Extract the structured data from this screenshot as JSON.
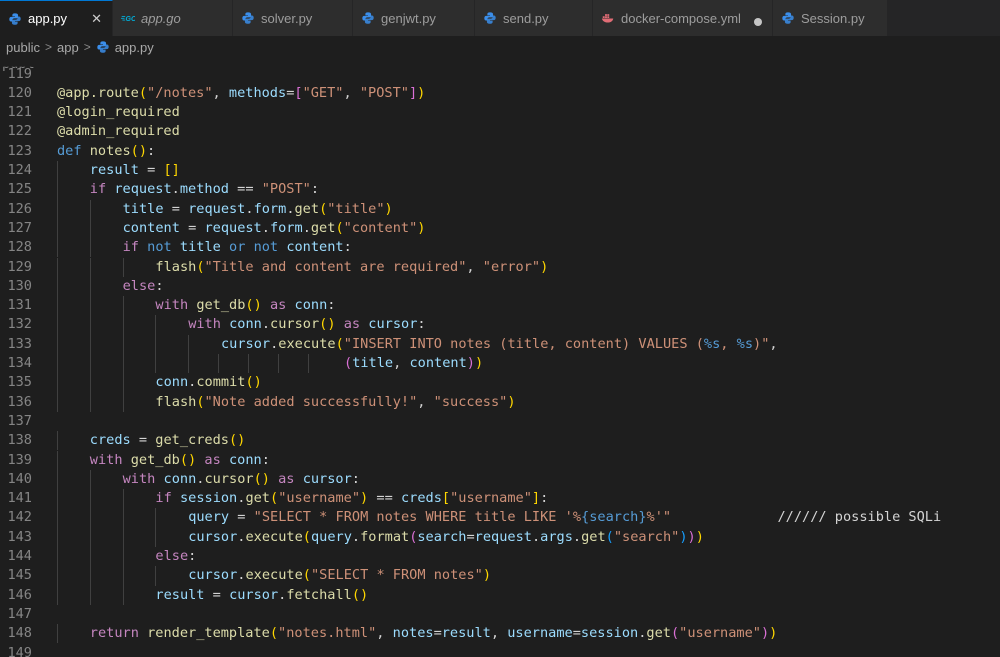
{
  "tabs": [
    {
      "label": "app.py",
      "icon": "python-icon",
      "active": true,
      "italic": false,
      "state": "close"
    },
    {
      "label": "app.go",
      "icon": "go-icon",
      "active": false,
      "italic": true,
      "state": ""
    },
    {
      "label": "solver.py",
      "icon": "python-icon",
      "active": false,
      "italic": false,
      "state": ""
    },
    {
      "label": "genjwt.py",
      "icon": "python-icon",
      "active": false,
      "italic": false,
      "state": ""
    },
    {
      "label": "send.py",
      "icon": "python-icon",
      "active": false,
      "italic": false,
      "state": ""
    },
    {
      "label": "docker-compose.yml",
      "icon": "docker-icon",
      "active": false,
      "italic": false,
      "state": "modified"
    },
    {
      "label": "Session.py",
      "icon": "python-icon",
      "active": false,
      "italic": false,
      "state": ""
    }
  ],
  "tab_close_glyph": "✕",
  "breadcrumb": {
    "items": [
      "public",
      "app",
      "app.py"
    ],
    "separator": ">"
  },
  "editor": {
    "top_partial_label": "public",
    "lines": [
      {
        "n": "119",
        "indent": 0,
        "tokens": []
      },
      {
        "n": "120",
        "indent": 0,
        "tokens": [
          [
            "deco",
            "@app.route"
          ],
          [
            "br1",
            "("
          ],
          [
            "str",
            "\"/notes\""
          ],
          [
            "plain",
            ", "
          ],
          [
            "var",
            "methods"
          ],
          [
            "plain",
            "="
          ],
          [
            "br2",
            "["
          ],
          [
            "str",
            "\"GET\""
          ],
          [
            "plain",
            ", "
          ],
          [
            "str",
            "\"POST\""
          ],
          [
            "br2",
            "]"
          ],
          [
            "br1",
            ")"
          ]
        ]
      },
      {
        "n": "121",
        "indent": 0,
        "tokens": [
          [
            "deco",
            "@login_required"
          ]
        ]
      },
      {
        "n": "122",
        "indent": 0,
        "tokens": [
          [
            "deco",
            "@admin_required"
          ]
        ]
      },
      {
        "n": "123",
        "indent": 0,
        "tokens": [
          [
            "kw",
            "def "
          ],
          [
            "fn",
            "notes"
          ],
          [
            "br1",
            "()"
          ],
          [
            "plain",
            ":"
          ]
        ]
      },
      {
        "n": "124",
        "indent": 1,
        "tokens": [
          [
            "var",
            "result"
          ],
          [
            "plain",
            " = "
          ],
          [
            "br1",
            "[]"
          ]
        ]
      },
      {
        "n": "125",
        "indent": 1,
        "tokens": [
          [
            "ctrl",
            "if "
          ],
          [
            "var",
            "request"
          ],
          [
            "plain",
            "."
          ],
          [
            "var",
            "method"
          ],
          [
            "plain",
            " == "
          ],
          [
            "str",
            "\"POST\""
          ],
          [
            "plain",
            ":"
          ]
        ]
      },
      {
        "n": "126",
        "indent": 2,
        "tokens": [
          [
            "var",
            "title"
          ],
          [
            "plain",
            " = "
          ],
          [
            "var",
            "request"
          ],
          [
            "plain",
            "."
          ],
          [
            "var",
            "form"
          ],
          [
            "plain",
            "."
          ],
          [
            "fn",
            "get"
          ],
          [
            "br1",
            "("
          ],
          [
            "str",
            "\"title\""
          ],
          [
            "br1",
            ")"
          ]
        ]
      },
      {
        "n": "127",
        "indent": 2,
        "tokens": [
          [
            "var",
            "content"
          ],
          [
            "plain",
            " = "
          ],
          [
            "var",
            "request"
          ],
          [
            "plain",
            "."
          ],
          [
            "var",
            "form"
          ],
          [
            "plain",
            "."
          ],
          [
            "fn",
            "get"
          ],
          [
            "br1",
            "("
          ],
          [
            "str",
            "\"content\""
          ],
          [
            "br1",
            ")"
          ]
        ]
      },
      {
        "n": "128",
        "indent": 2,
        "tokens": [
          [
            "ctrl",
            "if "
          ],
          [
            "kw",
            "not "
          ],
          [
            "var",
            "title "
          ],
          [
            "kw",
            "or not "
          ],
          [
            "var",
            "content"
          ],
          [
            "plain",
            ":"
          ]
        ]
      },
      {
        "n": "129",
        "indent": 3,
        "tokens": [
          [
            "fn",
            "flash"
          ],
          [
            "br1",
            "("
          ],
          [
            "str",
            "\"Title and content are required\""
          ],
          [
            "plain",
            ", "
          ],
          [
            "str",
            "\"error\""
          ],
          [
            "br1",
            ")"
          ]
        ]
      },
      {
        "n": "130",
        "indent": 2,
        "tokens": [
          [
            "ctrl",
            "else"
          ],
          [
            "plain",
            ":"
          ]
        ]
      },
      {
        "n": "131",
        "indent": 3,
        "tokens": [
          [
            "ctrl",
            "with "
          ],
          [
            "fn",
            "get_db"
          ],
          [
            "br1",
            "()"
          ],
          [
            "ctrl",
            " as "
          ],
          [
            "var",
            "conn"
          ],
          [
            "plain",
            ":"
          ]
        ]
      },
      {
        "n": "132",
        "indent": 4,
        "tokens": [
          [
            "ctrl",
            "with "
          ],
          [
            "var",
            "conn"
          ],
          [
            "plain",
            "."
          ],
          [
            "fn",
            "cursor"
          ],
          [
            "br1",
            "()"
          ],
          [
            "ctrl",
            " as "
          ],
          [
            "var",
            "cursor"
          ],
          [
            "plain",
            ":"
          ]
        ]
      },
      {
        "n": "133",
        "indent": 5,
        "tokens": [
          [
            "var",
            "cursor"
          ],
          [
            "plain",
            "."
          ],
          [
            "fn",
            "execute"
          ],
          [
            "br1",
            "("
          ],
          [
            "str",
            "\"INSERT INTO notes (title, content) VALUES ("
          ],
          [
            "fmt",
            "%s"
          ],
          [
            "str",
            ", "
          ],
          [
            "fmt",
            "%s"
          ],
          [
            "str",
            ")\""
          ],
          [
            "plain",
            ","
          ]
        ]
      },
      {
        "n": "134",
        "indent": 5,
        "pad": 15,
        "tokens": [
          [
            "br2",
            "("
          ],
          [
            "var",
            "title"
          ],
          [
            "plain",
            ", "
          ],
          [
            "var",
            "content"
          ],
          [
            "br2",
            ")"
          ],
          [
            "br1",
            ")"
          ]
        ]
      },
      {
        "n": "135",
        "indent": 3,
        "tokens": [
          [
            "var",
            "conn"
          ],
          [
            "plain",
            "."
          ],
          [
            "fn",
            "commit"
          ],
          [
            "br1",
            "()"
          ]
        ]
      },
      {
        "n": "136",
        "indent": 3,
        "tokens": [
          [
            "fn",
            "flash"
          ],
          [
            "br1",
            "("
          ],
          [
            "str",
            "\"Note added successfully!\""
          ],
          [
            "plain",
            ", "
          ],
          [
            "str",
            "\"success\""
          ],
          [
            "br1",
            ")"
          ]
        ]
      },
      {
        "n": "137",
        "indent": 0,
        "tokens": []
      },
      {
        "n": "138",
        "indent": 1,
        "tokens": [
          [
            "var",
            "creds"
          ],
          [
            "plain",
            " = "
          ],
          [
            "fn",
            "get_creds"
          ],
          [
            "br1",
            "()"
          ]
        ]
      },
      {
        "n": "139",
        "indent": 1,
        "tokens": [
          [
            "ctrl",
            "with "
          ],
          [
            "fn",
            "get_db"
          ],
          [
            "br1",
            "()"
          ],
          [
            "ctrl",
            " as "
          ],
          [
            "var",
            "conn"
          ],
          [
            "plain",
            ":"
          ]
        ]
      },
      {
        "n": "140",
        "indent": 2,
        "tokens": [
          [
            "ctrl",
            "with "
          ],
          [
            "var",
            "conn"
          ],
          [
            "plain",
            "."
          ],
          [
            "fn",
            "cursor"
          ],
          [
            "br1",
            "()"
          ],
          [
            "ctrl",
            " as "
          ],
          [
            "var",
            "cursor"
          ],
          [
            "plain",
            ":"
          ]
        ]
      },
      {
        "n": "141",
        "indent": 3,
        "tokens": [
          [
            "ctrl",
            "if "
          ],
          [
            "var",
            "session"
          ],
          [
            "plain",
            "."
          ],
          [
            "fn",
            "get"
          ],
          [
            "br1",
            "("
          ],
          [
            "str",
            "\"username\""
          ],
          [
            "br1",
            ")"
          ],
          [
            "plain",
            " == "
          ],
          [
            "var",
            "creds"
          ],
          [
            "br1",
            "["
          ],
          [
            "str",
            "\"username\""
          ],
          [
            "br1",
            "]"
          ],
          [
            "plain",
            ":"
          ]
        ]
      },
      {
        "n": "142",
        "indent": 4,
        "tokens": [
          [
            "var",
            "query"
          ],
          [
            "plain",
            " = "
          ],
          [
            "str",
            "\"SELECT * FROM notes WHERE title LIKE '%"
          ],
          [
            "fmt",
            "{search}"
          ],
          [
            "str",
            "%'\""
          ],
          [
            "plain",
            "             ////// possible SQLi"
          ]
        ]
      },
      {
        "n": "143",
        "indent": 4,
        "tokens": [
          [
            "var",
            "cursor"
          ],
          [
            "plain",
            "."
          ],
          [
            "fn",
            "execute"
          ],
          [
            "br1",
            "("
          ],
          [
            "var",
            "query"
          ],
          [
            "plain",
            "."
          ],
          [
            "fn",
            "format"
          ],
          [
            "br2",
            "("
          ],
          [
            "var",
            "search"
          ],
          [
            "plain",
            "="
          ],
          [
            "var",
            "request"
          ],
          [
            "plain",
            "."
          ],
          [
            "var",
            "args"
          ],
          [
            "plain",
            "."
          ],
          [
            "fn",
            "get"
          ],
          [
            "br3",
            "("
          ],
          [
            "str",
            "\"search\""
          ],
          [
            "br3",
            ")"
          ],
          [
            "br2",
            ")"
          ],
          [
            "br1",
            ")"
          ]
        ]
      },
      {
        "n": "144",
        "indent": 3,
        "tokens": [
          [
            "ctrl",
            "else"
          ],
          [
            "plain",
            ":"
          ]
        ]
      },
      {
        "n": "145",
        "indent": 4,
        "tokens": [
          [
            "var",
            "cursor"
          ],
          [
            "plain",
            "."
          ],
          [
            "fn",
            "execute"
          ],
          [
            "br1",
            "("
          ],
          [
            "str",
            "\"SELECT * FROM notes\""
          ],
          [
            "br1",
            ")"
          ]
        ]
      },
      {
        "n": "146",
        "indent": 3,
        "tokens": [
          [
            "var",
            "result"
          ],
          [
            "plain",
            " = "
          ],
          [
            "var",
            "cursor"
          ],
          [
            "plain",
            "."
          ],
          [
            "fn",
            "fetchall"
          ],
          [
            "br1",
            "()"
          ]
        ]
      },
      {
        "n": "147",
        "indent": 0,
        "tokens": []
      },
      {
        "n": "148",
        "indent": 1,
        "tokens": [
          [
            "ctrl",
            "return "
          ],
          [
            "fn",
            "render_template"
          ],
          [
            "br1",
            "("
          ],
          [
            "str",
            "\"notes.html\""
          ],
          [
            "plain",
            ", "
          ],
          [
            "var",
            "notes"
          ],
          [
            "plain",
            "="
          ],
          [
            "var",
            "result"
          ],
          [
            "plain",
            ", "
          ],
          [
            "var",
            "username"
          ],
          [
            "plain",
            "="
          ],
          [
            "var",
            "session"
          ],
          [
            "plain",
            "."
          ],
          [
            "fn",
            "get"
          ],
          [
            "br2",
            "("
          ],
          [
            "str",
            "\"username\""
          ],
          [
            "br2",
            ")"
          ],
          [
            "br1",
            ")"
          ]
        ]
      },
      {
        "n": "149",
        "indent": 0,
        "tokens": []
      }
    ]
  },
  "colors": {
    "accent": "#0078d4",
    "python": "#3b8eea",
    "go": "#00add8",
    "docker": "#e06c75"
  }
}
